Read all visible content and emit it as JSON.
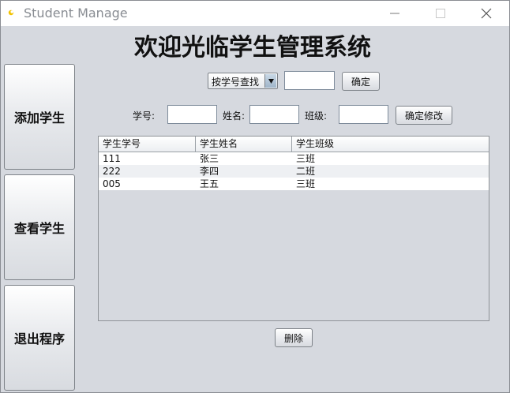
{
  "window": {
    "title": "Student Manage"
  },
  "heading": "欢迎光临学生管理系统",
  "sidebar": {
    "add_label": "添加学生",
    "view_label": "查看学生",
    "exit_label": "退出程序"
  },
  "search": {
    "mode_selected": "按学号查找",
    "query_value": "",
    "confirm_label": "确定"
  },
  "edit_form": {
    "id_label": "学号:",
    "id_value": "",
    "name_label": "姓名:",
    "name_value": "",
    "class_label": "班级:",
    "class_value": "",
    "confirm_label": "确定修改"
  },
  "table": {
    "columns": [
      "学生学号",
      "学生姓名",
      "学生班级"
    ],
    "rows": [
      [
        "111",
        "张三",
        "三班"
      ],
      [
        "222",
        "李四",
        "二班"
      ],
      [
        "005",
        "王五",
        "三班"
      ]
    ]
  },
  "delete_label": "删除",
  "colors": {
    "window_bg": "#d6d9df",
    "titlebar_bg": "#ffffff"
  }
}
